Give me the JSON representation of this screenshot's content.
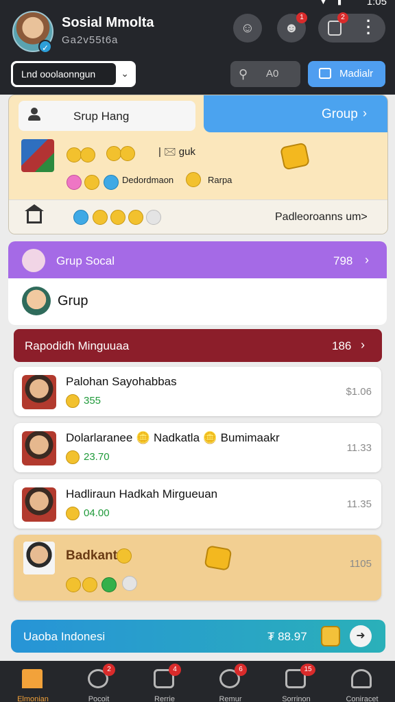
{
  "status": {
    "time": "1:05"
  },
  "header": {
    "title": "Sosial Mmolta",
    "subtitle": "Ga2v55t6a",
    "notification_badge_1": "1",
    "notification_badge_2": "2"
  },
  "toolbar": {
    "language_label": "Lnd ooolaonngun",
    "search_label": "A0",
    "media_label": "Madialr"
  },
  "top_card": {
    "search_label": "Srup Hang",
    "group_label": "Group",
    "line1": "| 🖂 guk",
    "line2": "Dedordmaon",
    "line2b": "Rarpa",
    "footer_text": "Padleoroanns um>"
  },
  "group_social": {
    "title": "Grup Socal",
    "count": "798",
    "member_name": "Grup"
  },
  "red_section": {
    "title": "Rapodidh Minguuaa",
    "count": "186"
  },
  "list_items": [
    {
      "name": "Palohan Sayohabbas",
      "value": "355",
      "time": "$1.06"
    },
    {
      "name": "Dolarlaranee 🪙 Nadkatla 🪙 Bumimaakr",
      "value": "23.70",
      "time": "11.33"
    },
    {
      "name": "Hadliraun Hadkah Mirgueuan",
      "value": "04.00",
      "time": "11.35"
    }
  ],
  "gold_card": {
    "name": "Badkant",
    "time": "1105"
  },
  "teal_bar": {
    "title": "Uaoba Indonesi",
    "amount": "₮ 88.97"
  },
  "bottom_nav": [
    {
      "label": "Elmonian",
      "badge": ""
    },
    {
      "label": "Pocoit",
      "badge": "2"
    },
    {
      "label": "Rerrie",
      "badge": "4"
    },
    {
      "label": "Remur",
      "badge": "6"
    },
    {
      "label": "Sorrinon",
      "badge": "15"
    },
    {
      "label": "Coniracet",
      "badge": ""
    }
  ]
}
